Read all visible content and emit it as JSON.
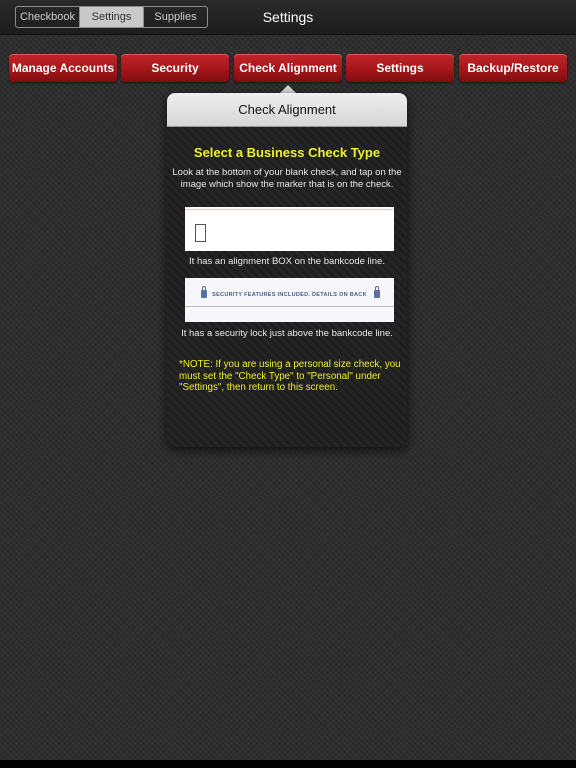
{
  "navbar": {
    "title": "Settings",
    "segments": [
      "Checkbook",
      "Settings",
      "Supplies"
    ],
    "selected_segment": "Settings"
  },
  "tabs": [
    {
      "label": "Manage Accounts"
    },
    {
      "label": "Security"
    },
    {
      "label": "Check Alignment"
    },
    {
      "label": "Settings"
    },
    {
      "label": "Backup/Restore"
    }
  ],
  "popover": {
    "title": "Check Alignment",
    "heading": "Select a Business Check Type",
    "instruction": "Look at the bottom of your blank check, and tap on the image which show the marker that is on the check.",
    "options": [
      {
        "caption": "It has an alignment BOX on the bankcode line."
      },
      {
        "image_text": "SECURITY FEATURES INCLUDED. DETAILS ON BACK",
        "caption": "It has a security lock just above the bankcode line."
      }
    ],
    "note": "*NOTE: If you are using a personal size check, you must set the \"Check Type\" to \"Personal\" under \"Settings\", then return to this screen."
  },
  "colors": {
    "tab_red": "#a4161a",
    "heading_yellow": "#f0f02a",
    "background": "#2b2b2b"
  }
}
